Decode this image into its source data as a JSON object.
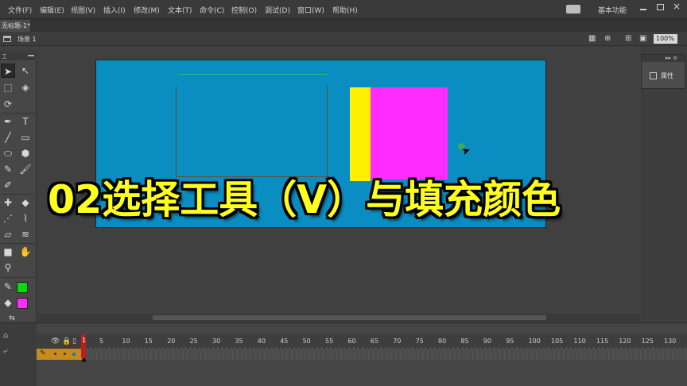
{
  "menu": [
    "文件(F)",
    "编辑(E)",
    "视图(V)",
    "插入(I)",
    "修改(M)",
    "文本(T)",
    "命令(C)",
    "控制(O)",
    "调试(D)",
    "窗口(W)",
    "帮助(H)"
  ],
  "workspace_label": "基本功能",
  "doc_tab": {
    "title": "无标题-1*",
    "close": "×"
  },
  "scene_label": "场景 1",
  "zoom": "100%",
  "tools_header": "工",
  "stage": {
    "background": "#0a8dc0",
    "yellow": "#ffef00",
    "magenta": "#ff2bff"
  },
  "overlay_title": "02选择工具（V）与填充颜色",
  "props_label": "属性",
  "colors": {
    "stroke": "#00dd00",
    "fill": "#ff2bff"
  },
  "timeline": {
    "playhead_frame": "1",
    "frame_numbers": [
      "5",
      "10",
      "15",
      "20",
      "25",
      "30",
      "35",
      "40",
      "45",
      "50",
      "55",
      "60",
      "65",
      "70",
      "75",
      "80",
      "85",
      "90",
      "95",
      "100",
      "105",
      "110",
      "115",
      "120",
      "125",
      "130"
    ]
  }
}
